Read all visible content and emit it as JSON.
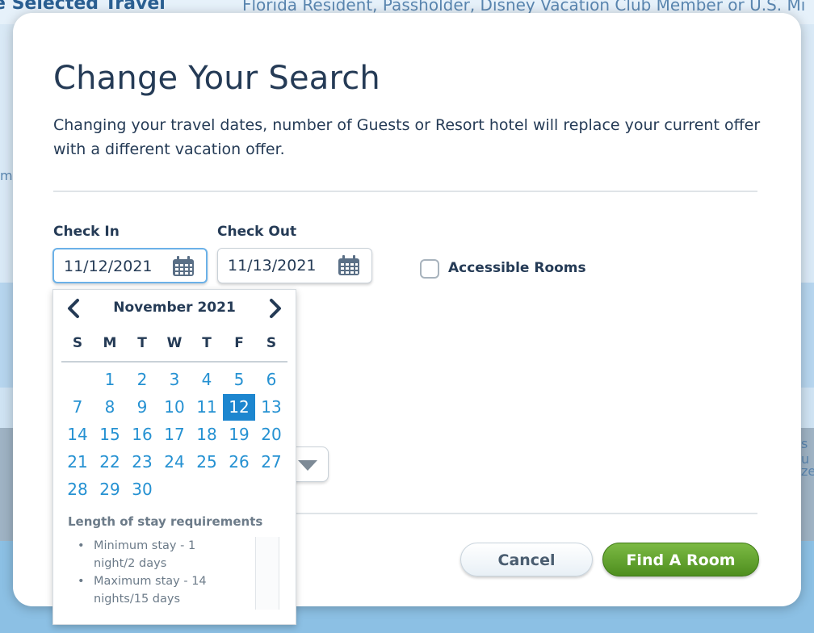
{
  "background": {
    "top_left_text": "e Selected Travel",
    "top_right_text": "Florida Resident, Passholder, Disney Vacation Club Member or U.S. Mi",
    "left_fragment": "m",
    "right_fragment_1": "s u",
    "right_fragment_2": "ze"
  },
  "modal": {
    "title": "Change Your Search",
    "intro": "Changing your travel dates, number of Guests or Resort hotel will replace your current offer with a different vacation offer."
  },
  "check_in": {
    "label": "Check In",
    "value": "11/12/2021"
  },
  "check_out": {
    "label": "Check Out",
    "value": "11/13/2021"
  },
  "accessible": {
    "label": "Accessible Rooms",
    "checked": false
  },
  "calendar": {
    "month": "November 2021",
    "weekdays": [
      "S",
      "M",
      "T",
      "W",
      "T",
      "F",
      "S"
    ],
    "first_weekday_index": 1,
    "days_in_month": 30,
    "selected_day": 12,
    "requirements_title": "Length of stay requirements",
    "requirements": [
      "Minimum stay - 1 night/2 days",
      "Maximum stay - 14 nights/15 days"
    ],
    "bullet": "•"
  },
  "buttons": {
    "cancel": "Cancel",
    "find": "Find A Room"
  },
  "colors": {
    "link_blue": "#2591d2",
    "selected_blue": "#1d86cf",
    "primary_green": "#5a9e2a",
    "heading_navy": "#253b56"
  }
}
